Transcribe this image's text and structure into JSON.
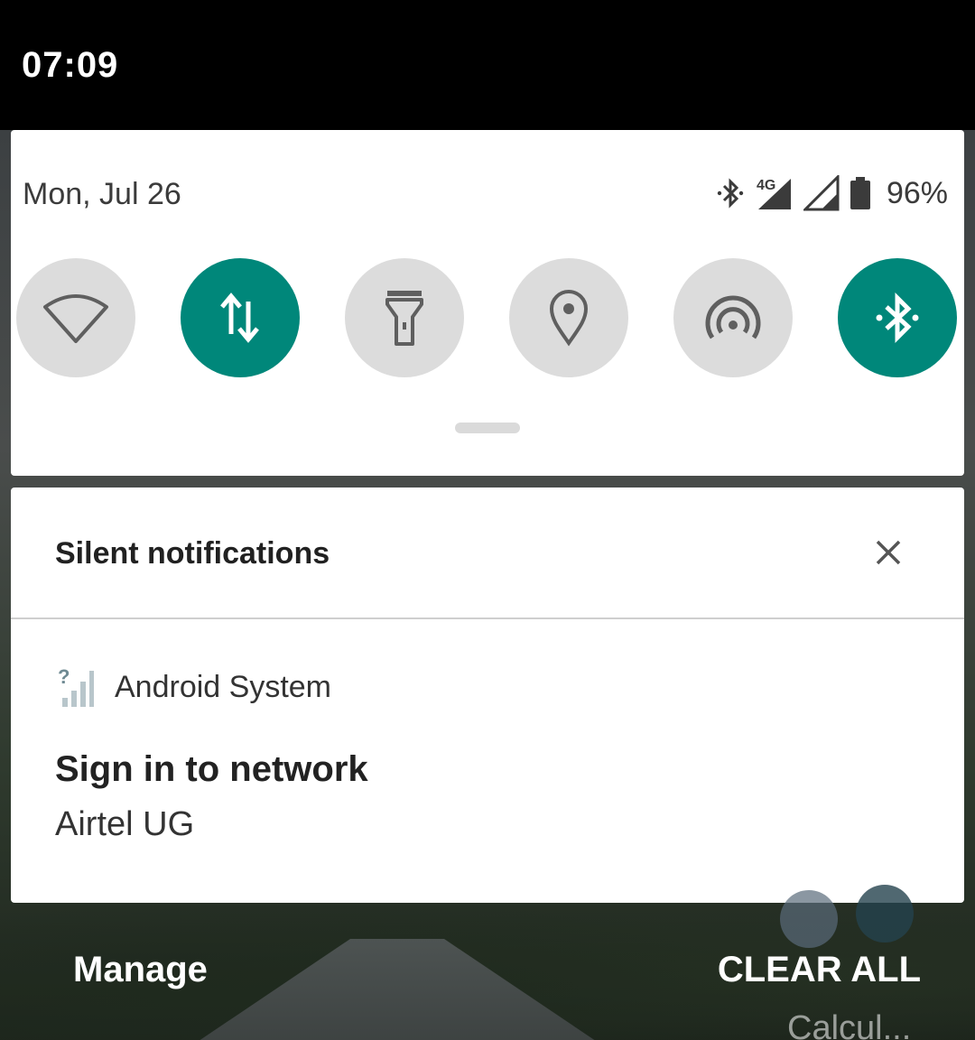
{
  "status_bar": {
    "time": "07:09"
  },
  "quick_settings": {
    "date": "Mon, Jul 26",
    "battery_percent": "96%",
    "network_type": "4G",
    "tiles": [
      {
        "name": "wifi",
        "icon": "wifi-icon",
        "active": false
      },
      {
        "name": "mobile-data",
        "icon": "data-arrows-icon",
        "active": true
      },
      {
        "name": "flashlight",
        "icon": "flashlight-icon",
        "active": false
      },
      {
        "name": "location",
        "icon": "location-pin-icon",
        "active": false
      },
      {
        "name": "hotspot",
        "icon": "hotspot-icon",
        "active": false
      },
      {
        "name": "bluetooth",
        "icon": "bluetooth-icon",
        "active": true
      }
    ],
    "accent_color": "#00877a"
  },
  "notification_group": {
    "header": "Silent notifications",
    "app_name": "Android System",
    "title": "Sign in to network",
    "text": "Airtel UG"
  },
  "footer": {
    "manage_label": "Manage",
    "clear_all_label": "CLEAR ALL",
    "background_app_label": "Calcul..."
  }
}
